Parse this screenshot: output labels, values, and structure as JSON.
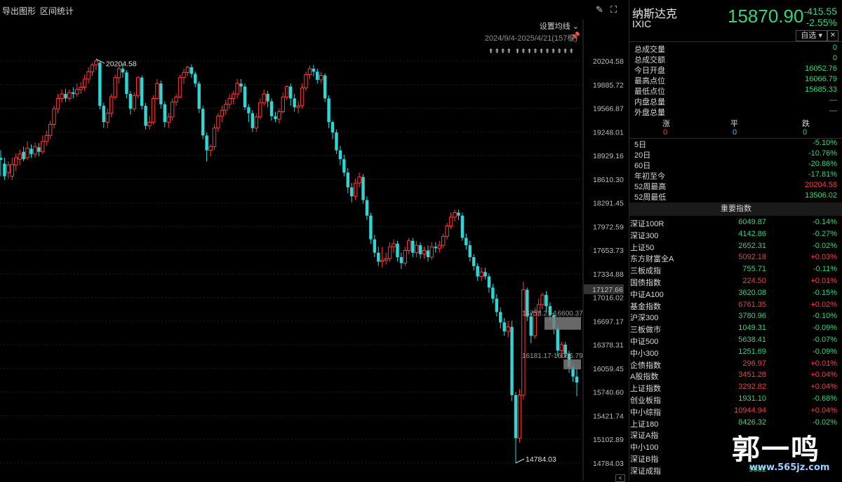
{
  "toolbar": {
    "export_label": "导出图形",
    "range_stats_label": "区间统计",
    "edit_icon": "pen-icon",
    "fullscreen_icon": "expand-icon"
  },
  "chart_header": {
    "ma_setting": "设置均线",
    "date_range": "2024/9/4-2025/4/21(157根)",
    "arrows": "⇞⇞⇞⇞ ⇞⇞⇞⇞⇞⇞⇞⇞⇞⇞"
  },
  "chart_data": {
    "type": "candlestick",
    "ylim": [
      14784.03,
      20204.58
    ],
    "y_ticks": [
      "20204.58",
      "19885.72",
      "19566.87",
      "19248.01",
      "18929.16",
      "18610.30",
      "18291.45",
      "17972.59",
      "17653.73",
      "17334.88",
      "17016.02",
      "16697.17",
      "16378.31",
      "16059.45",
      "15740.60",
      "15421.74",
      "15102.89",
      "14784.03"
    ],
    "current_price_tag": "17127.66",
    "annotations": {
      "high": "20204.58",
      "low": "14784.03",
      "box1": "16753.21-16600.37",
      "box2": "16181.17-16066.79"
    },
    "candles": [
      [
        18900,
        18870,
        19000,
        18650
      ],
      [
        18820,
        18650,
        18900,
        18600
      ],
      [
        18700,
        18800,
        18850,
        18620
      ],
      [
        18650,
        18810,
        18900,
        18600
      ],
      [
        18800,
        18900,
        18960,
        18720
      ],
      [
        18880,
        18950,
        19010,
        18800
      ],
      [
        18980,
        18880,
        19050,
        18850
      ],
      [
        18900,
        19030,
        19120,
        18870
      ],
      [
        19020,
        18950,
        19080,
        18900
      ],
      [
        18950,
        19050,
        19100,
        18900
      ],
      [
        19040,
        18980,
        19100,
        18920
      ],
      [
        18980,
        19120,
        19200,
        18950
      ],
      [
        19120,
        19200,
        19260,
        19060
      ],
      [
        19200,
        19350,
        19400,
        19150
      ],
      [
        19350,
        19560,
        19600,
        19300
      ],
      [
        19560,
        19700,
        19760,
        19500
      ],
      [
        19700,
        19760,
        19820,
        19640
      ],
      [
        19760,
        19700,
        19830,
        19650
      ],
      [
        19700,
        19780,
        19820,
        19660
      ],
      [
        19780,
        19760,
        19850,
        19700
      ],
      [
        19760,
        19820,
        19900,
        19720
      ],
      [
        19820,
        19850,
        19920,
        19760
      ],
      [
        19850,
        19960,
        20020,
        19800
      ],
      [
        19960,
        20060,
        20120,
        19900
      ],
      [
        20060,
        20150,
        20180,
        20000
      ],
      [
        20150,
        20204,
        20230,
        20080
      ],
      [
        20180,
        19600,
        20200,
        19550
      ],
      [
        19600,
        19380,
        19640,
        19300
      ],
      [
        19380,
        19500,
        19560,
        19300
      ],
      [
        19500,
        19720,
        19760,
        19450
      ],
      [
        19720,
        19980,
        20020,
        19680
      ],
      [
        19980,
        20100,
        20150,
        19900
      ],
      [
        20100,
        20050,
        20160,
        19980
      ],
      [
        20050,
        19760,
        20080,
        19700
      ],
      [
        19760,
        19560,
        19800,
        19480
      ],
      [
        19560,
        19740,
        19780,
        19520
      ],
      [
        19740,
        19980,
        20000,
        19700
      ],
      [
        19980,
        19600,
        20010,
        19550
      ],
      [
        19600,
        19330,
        19640,
        19280
      ],
      [
        19330,
        19380,
        19460,
        19280
      ],
      [
        19380,
        19700,
        19740,
        19350
      ],
      [
        19700,
        19900,
        19960,
        19680
      ],
      [
        19900,
        19620,
        19940,
        19560
      ],
      [
        19620,
        19380,
        19660,
        19310
      ],
      [
        19380,
        19450,
        19500,
        19300
      ],
      [
        19450,
        19650,
        19700,
        19400
      ],
      [
        19650,
        19720,
        19760,
        19600
      ],
      [
        19720,
        19980,
        20020,
        19700
      ],
      [
        19980,
        20050,
        20100,
        19900
      ],
      [
        20050,
        20120,
        20140,
        20000
      ],
      [
        20120,
        20030,
        20160,
        19980
      ],
      [
        20030,
        19900,
        20060,
        19850
      ],
      [
        19900,
        19560,
        19930,
        19500
      ],
      [
        19560,
        19200,
        19600,
        19150
      ],
      [
        19200,
        19000,
        19240,
        18850
      ],
      [
        19000,
        19050,
        19080,
        18920
      ],
      [
        19050,
        19300,
        19350,
        19000
      ],
      [
        19300,
        19460,
        19500,
        19250
      ],
      [
        19460,
        19540,
        19600,
        19380
      ],
      [
        19540,
        19620,
        19680,
        19480
      ],
      [
        19620,
        19700,
        19760,
        19560
      ],
      [
        19700,
        19760,
        19800,
        19620
      ],
      [
        19760,
        19900,
        19960,
        19700
      ],
      [
        19900,
        19860,
        19960,
        19780
      ],
      [
        19860,
        19580,
        19900,
        19540
      ],
      [
        19580,
        19500,
        19620,
        19380
      ],
      [
        19500,
        19300,
        19540,
        19250
      ],
      [
        19300,
        19450,
        19500,
        19250
      ],
      [
        19450,
        19640,
        19700,
        19420
      ],
      [
        19640,
        19760,
        19820,
        19600
      ],
      [
        19760,
        19660,
        19800,
        19580
      ],
      [
        19660,
        19460,
        19700,
        19400
      ],
      [
        19460,
        19420,
        19520,
        19380
      ],
      [
        19420,
        19520,
        19560,
        19360
      ],
      [
        19520,
        19720,
        19780,
        19500
      ],
      [
        19720,
        19860,
        19880,
        19680
      ],
      [
        19860,
        19700,
        19900,
        19600
      ],
      [
        19700,
        19580,
        19760,
        19520
      ],
      [
        19580,
        19600,
        19660,
        19500
      ],
      [
        19600,
        19840,
        19900,
        19560
      ],
      [
        19840,
        20020,
        20060,
        19800
      ],
      [
        20020,
        20100,
        20140,
        19960
      ],
      [
        20100,
        20060,
        20150,
        20000
      ],
      [
        20060,
        19950,
        20100,
        19900
      ],
      [
        19950,
        20010,
        20060,
        19900
      ],
      [
        20010,
        19700,
        20040,
        19650
      ],
      [
        19700,
        19380,
        19740,
        19300
      ],
      [
        19380,
        19240,
        19400,
        19150
      ],
      [
        19240,
        19000,
        19280,
        18950
      ],
      [
        19000,
        18880,
        19060,
        18800
      ],
      [
        18880,
        18700,
        18940,
        18650
      ],
      [
        18700,
        18500,
        18760,
        18420
      ],
      [
        18500,
        18380,
        18560,
        18300
      ],
      [
        18380,
        18560,
        18620,
        18330
      ],
      [
        18560,
        18640,
        18700,
        18500
      ],
      [
        18640,
        18330,
        18680,
        18280
      ],
      [
        18330,
        18120,
        18380,
        18060
      ],
      [
        18120,
        17800,
        18160,
        17740
      ],
      [
        17800,
        17620,
        17860,
        17560
      ],
      [
        17620,
        17500,
        17700,
        17440
      ],
      [
        17500,
        17520,
        17700,
        17420
      ],
      [
        17520,
        17540,
        17620,
        17460
      ],
      [
        17540,
        17700,
        17760,
        17500
      ],
      [
        17700,
        17740,
        17800,
        17620
      ],
      [
        17740,
        17560,
        17780,
        17500
      ],
      [
        17560,
        17480,
        17620,
        17400
      ],
      [
        17480,
        17650,
        17700,
        17440
      ],
      [
        17650,
        17780,
        17820,
        17600
      ],
      [
        17780,
        17620,
        17820,
        17560
      ],
      [
        17620,
        17720,
        17780,
        17560
      ],
      [
        17720,
        17600,
        17760,
        17540
      ],
      [
        17600,
        17650,
        17700,
        17540
      ],
      [
        17650,
        17560,
        17720,
        17500
      ],
      [
        17560,
        17700,
        17760,
        17520
      ],
      [
        17700,
        17680,
        17760,
        17620
      ],
      [
        17680,
        17720,
        17780,
        17620
      ],
      [
        17720,
        17840,
        17880,
        17680
      ],
      [
        17840,
        17980,
        18020,
        17800
      ],
      [
        17980,
        18100,
        18160,
        17940
      ],
      [
        18100,
        18160,
        18200,
        18040
      ],
      [
        18160,
        18120,
        18200,
        18060
      ],
      [
        18120,
        17820,
        18160,
        17780
      ],
      [
        17820,
        17720,
        17880,
        17660
      ],
      [
        17720,
        17560,
        17780,
        17500
      ],
      [
        17560,
        17440,
        17600,
        17380
      ],
      [
        17440,
        17300,
        17480,
        17240
      ],
      [
        17300,
        17360,
        17420,
        17240
      ],
      [
        17360,
        17300,
        17420,
        17260
      ],
      [
        17300,
        17150,
        17340,
        17080
      ],
      [
        17150,
        17000,
        17200,
        16940
      ],
      [
        17000,
        16820,
        17060,
        16760
      ],
      [
        16820,
        16680,
        16880,
        16600
      ],
      [
        16680,
        16560,
        16740,
        16500
      ],
      [
        16560,
        16620,
        16700,
        16480
      ],
      [
        16620,
        15700,
        16700,
        15620
      ],
      [
        15700,
        15120,
        15740,
        14784
      ],
      [
        15120,
        15700,
        15780,
        15060
      ],
      [
        15700,
        17120,
        17230,
        15640
      ],
      [
        17120,
        16760,
        17150,
        16700
      ],
      [
        16760,
        16500,
        16820,
        16400
      ],
      [
        16500,
        16820,
        16880,
        16460
      ],
      [
        16820,
        16920,
        17000,
        16760
      ],
      [
        16920,
        17050,
        17080,
        16860
      ],
      [
        17050,
        16900,
        17100,
        16820
      ],
      [
        16900,
        16780,
        16950,
        16700
      ],
      [
        16780,
        16600,
        16820,
        16520
      ],
      [
        16600,
        16300,
        16640,
        16220
      ],
      [
        16300,
        16380,
        16420,
        16200
      ],
      [
        16380,
        16260,
        16420,
        16200
      ],
      [
        16260,
        16080,
        16300,
        16000
      ],
      [
        16080,
        15950,
        16120,
        15880
      ],
      [
        15950,
        15870,
        16066,
        15685
      ]
    ]
  },
  "quote": {
    "name": "纳斯达克",
    "code": "IXIC",
    "price": "15870.90",
    "change": "-415.55",
    "change_pct": "-2.55%",
    "watch_label": "自选 ▾",
    "close_icon": "close-icon"
  },
  "stats": [
    {
      "k": "总成交量",
      "v": "0",
      "c": "green"
    },
    {
      "k": "总成交额",
      "v": "0",
      "c": "green"
    },
    {
      "k": "今日开盘",
      "v": "16052.76",
      "c": "green"
    },
    {
      "k": "最高点位",
      "v": "16066.79",
      "c": "green"
    },
    {
      "k": "最低点位",
      "v": "15685.33",
      "c": "green"
    },
    {
      "k": "内盘总量",
      "v": "—",
      "c": "grey"
    },
    {
      "k": "外盘总量",
      "v": "—",
      "c": "grey"
    }
  ],
  "counts": {
    "up_label": "涨",
    "flat_label": "平",
    "down_label": "跌",
    "up": "0",
    "flat": "0",
    "down": "0"
  },
  "periods": [
    {
      "k": "5日",
      "v": "-5.10%",
      "c": "green"
    },
    {
      "k": "20日",
      "v": "-10.76%",
      "c": "green"
    },
    {
      "k": "60日",
      "v": "-20.86%",
      "c": "green"
    },
    {
      "k": "年初至今",
      "v": "-17.81%",
      "c": "green"
    },
    {
      "k": "52周最高",
      "v": "20204.58",
      "c": "red"
    },
    {
      "k": "52周最低",
      "v": "13506.02",
      "c": "green"
    }
  ],
  "important_header": "重要指数",
  "indices": [
    {
      "n": "深证100R",
      "p": "6049.87",
      "c": "-0.14%",
      "col": "green"
    },
    {
      "n": "深证300",
      "p": "4142.86",
      "c": "-0.27%",
      "col": "green"
    },
    {
      "n": "上证50",
      "p": "2652.31",
      "c": "-0.02%",
      "col": "green"
    },
    {
      "n": "东方财富全A",
      "p": "5092.18",
      "c": "+0.03%",
      "col": "red"
    },
    {
      "n": "三板成指",
      "p": "755.71",
      "c": "-0.11%",
      "col": "green"
    },
    {
      "n": "国债指数",
      "p": "224.50",
      "c": "+0.01%",
      "col": "red"
    },
    {
      "n": "中证A100",
      "p": "3620.08",
      "c": "-0.15%",
      "col": "green"
    },
    {
      "n": "基金指数",
      "p": "6761.35",
      "c": "+0.02%",
      "col": "red"
    },
    {
      "n": "沪深300",
      "p": "3780.96",
      "c": "-0.10%",
      "col": "green"
    },
    {
      "n": "三板做市",
      "p": "1049.31",
      "c": "-0.09%",
      "col": "green"
    },
    {
      "n": "中证500",
      "p": "5638.41",
      "c": "-0.07%",
      "col": "green"
    },
    {
      "n": "中小300",
      "p": "1251.69",
      "c": "-0.09%",
      "col": "green"
    },
    {
      "n": "企债指数",
      "p": "296.97",
      "c": "+0.01%",
      "col": "red"
    },
    {
      "n": "A股指数",
      "p": "3451.28",
      "c": "+0.04%",
      "col": "red"
    },
    {
      "n": "上证指数",
      "p": "3292.82",
      "c": "+0.04%",
      "col": "red"
    },
    {
      "n": "创业板指",
      "p": "1931.10",
      "c": "-0.68%",
      "col": "green"
    },
    {
      "n": "中小综指",
      "p": "10944.94",
      "c": "+0.04%",
      "col": "red"
    },
    {
      "n": "上证180",
      "p": "8426.32",
      "c": "-0.02%",
      "col": "green"
    },
    {
      "n": "深证A指",
      "p": "",
      "c": "",
      "col": "red"
    },
    {
      "n": "中小100",
      "p": "",
      "c": "",
      "col": "green"
    },
    {
      "n": "深证B指",
      "p": "",
      "c": "",
      "col": "green"
    },
    {
      "n": "深证成指",
      "p": "9882",
      "c": "",
      "col": "green"
    }
  ],
  "watermark": {
    "text": "郭一鸣",
    "url": "www.565jz.com"
  }
}
